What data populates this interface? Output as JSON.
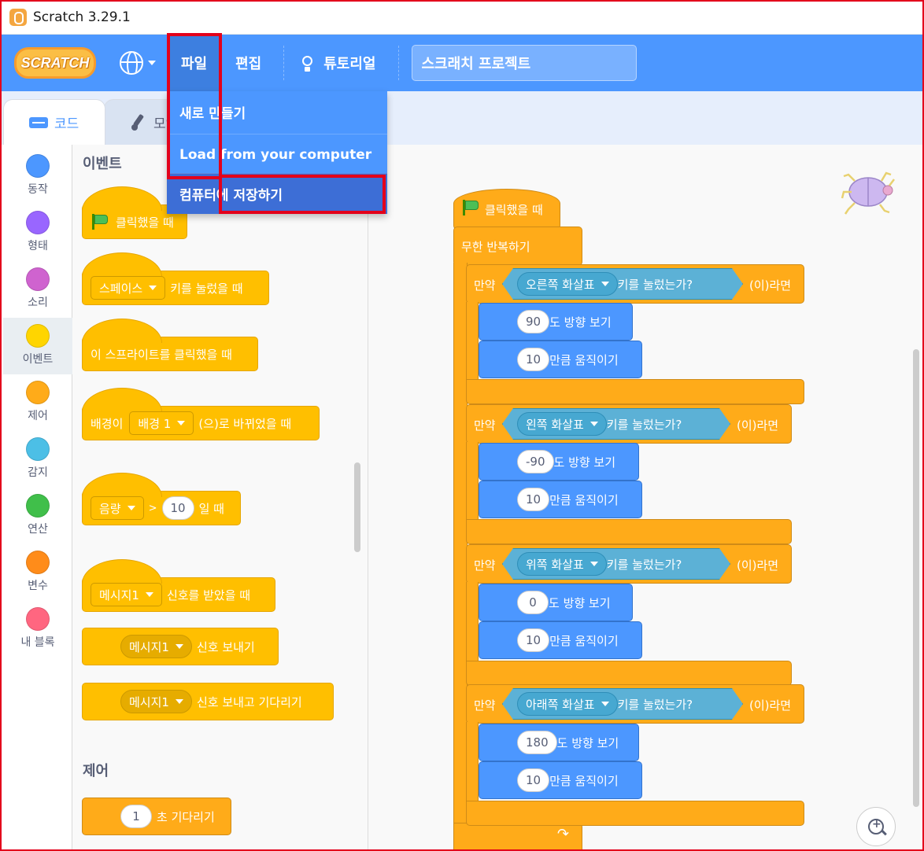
{
  "window": {
    "title": "Scratch 3.29.1"
  },
  "menubar": {
    "logo_text": "SCRATCH",
    "file": "파일",
    "edit": "편집",
    "tutorials": "튜토리얼",
    "project_title": "스크래치 프로젝트"
  },
  "file_menu": {
    "items": [
      "새로 만들기",
      "Load from your computer",
      "컴퓨터에 저장하기"
    ],
    "hovered_index": 2
  },
  "tabs": {
    "code": "코드",
    "costumes": "모양"
  },
  "categories": [
    {
      "label": "동작",
      "color": "#4c97ff"
    },
    {
      "label": "형태",
      "color": "#9966ff"
    },
    {
      "label": "소리",
      "color": "#cf63cf"
    },
    {
      "label": "이벤트",
      "color": "#ffd500"
    },
    {
      "label": "제어",
      "color": "#ffab19"
    },
    {
      "label": "감지",
      "color": "#4cbfe6"
    },
    {
      "label": "연산",
      "color": "#40bf4a"
    },
    {
      "label": "변수",
      "color": "#ff8c1a"
    },
    {
      "label": "내 블록",
      "color": "#ff6680"
    }
  ],
  "selected_category": "이벤트",
  "palette": {
    "events_header": "이벤트",
    "control_header": "제어",
    "flag_clicked": "클릭했을 때",
    "key_pressed_pre": "스페이스",
    "key_pressed_post": "키를 눌렀을 때",
    "sprite_clicked": "이 스프라이트를 클릭했을 때",
    "backdrop_pre": "배경이",
    "backdrop_value": "배경 1",
    "backdrop_post": "(으)로 바뀌었을 때",
    "loudness_drop": "음량",
    "loudness_op": ">",
    "loudness_value": "10",
    "loudness_post": "일 때",
    "receive_drop": "메시지1",
    "receive_post": "신호를 받았을 때",
    "broadcast_drop": "메시지1",
    "broadcast_post": "신호 보내기",
    "broadcast_wait_drop": "메시지1",
    "broadcast_wait_post": "신호 보내고 기다리기",
    "wait_value": "1",
    "wait_post": "초 기다리기"
  },
  "script": {
    "hat": "클릭했을 때",
    "forever": "무한 반복하기",
    "if_label": "만약",
    "then_label": "(이)라면",
    "key_question": "키를 눌렀는가?",
    "point_label": "도 방향 보기",
    "move_label": "만큼 움직이기",
    "branches": [
      {
        "key": "오른쪽 화살표",
        "direction": "90",
        "steps": "10"
      },
      {
        "key": "왼쪽 화살표",
        "direction": "-90",
        "steps": "10"
      },
      {
        "key": "위쪽 화살표",
        "direction": "0",
        "steps": "10"
      },
      {
        "key": "아래쪽 화살표",
        "direction": "180",
        "steps": "10"
      }
    ]
  }
}
